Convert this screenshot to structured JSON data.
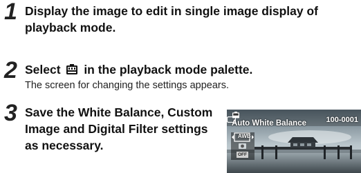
{
  "steps": [
    {
      "number": "1",
      "title": "Display the image to edit in single image display of playback mode."
    },
    {
      "number": "2",
      "title_before_icon": "Select",
      "title_icon": "user-settings-icon",
      "title_after_icon": "in the playback mode palette.",
      "description": "The screen for changing the settings appears."
    },
    {
      "number": "3",
      "title": "Save the White Balance, Custom Image and Digital Filter settings as necessary."
    }
  ],
  "camera_screen": {
    "mode_icon": "user-settings-icon",
    "title": "Auto White Balance",
    "folder_file": "100-0001",
    "folder_icon": "card-icon",
    "menu_items": [
      {
        "label": "AWB",
        "selected": true
      },
      {
        "label": "",
        "icon": "custom-image-icon",
        "selected": false
      },
      {
        "label": "OFF",
        "selected": false
      }
    ],
    "colors": {
      "sky_top": "#6f7f8a",
      "sky_bottom": "#c9d2d6",
      "water": "#4f5a60",
      "selection": "#e9eef0"
    }
  }
}
